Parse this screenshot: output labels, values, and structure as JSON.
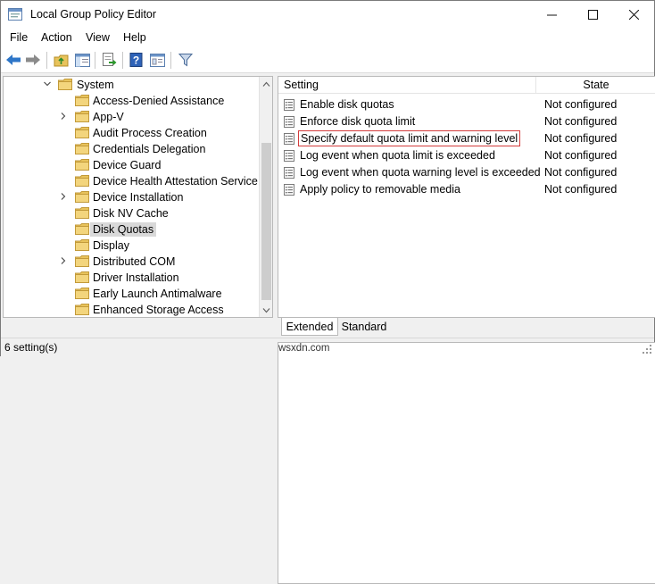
{
  "window": {
    "title": "Local Group Policy Editor",
    "min_glyph": "—",
    "max_glyph": "☐",
    "close_glyph": "✕"
  },
  "menu": [
    "File",
    "Action",
    "View",
    "Help"
  ],
  "toolbar": {
    "icons": [
      "back-arrow-icon",
      "forward-arrow-icon",
      "up-folder-icon",
      "show-hide-tree-icon",
      "export-list-icon",
      "help-icon",
      "properties-icon",
      "filter-icon"
    ]
  },
  "tree": {
    "root": {
      "label": "System",
      "expanded": true
    },
    "items": [
      {
        "label": "Access-Denied Assistance",
        "expandable": false,
        "selected": false
      },
      {
        "label": "App-V",
        "expandable": true,
        "selected": false
      },
      {
        "label": "Audit Process Creation",
        "expandable": false,
        "selected": false
      },
      {
        "label": "Credentials Delegation",
        "expandable": false,
        "selected": false
      },
      {
        "label": "Device Guard",
        "expandable": false,
        "selected": false
      },
      {
        "label": "Device Health Attestation Service",
        "expandable": false,
        "selected": false
      },
      {
        "label": "Device Installation",
        "expandable": true,
        "selected": false
      },
      {
        "label": "Disk NV Cache",
        "expandable": false,
        "selected": false
      },
      {
        "label": "Disk Quotas",
        "expandable": false,
        "selected": true
      },
      {
        "label": "Display",
        "expandable": false,
        "selected": false
      },
      {
        "label": "Distributed COM",
        "expandable": true,
        "selected": false
      },
      {
        "label": "Driver Installation",
        "expandable": false,
        "selected": false
      },
      {
        "label": "Early Launch Antimalware",
        "expandable": false,
        "selected": false
      },
      {
        "label": "Enhanced Storage Access",
        "expandable": false,
        "selected": false
      }
    ]
  },
  "list": {
    "columns": {
      "setting": "Setting",
      "state": "State"
    },
    "rows": [
      {
        "setting": "Enable disk quotas",
        "state": "Not configured",
        "highlighted": false
      },
      {
        "setting": "Enforce disk quota limit",
        "state": "Not configured",
        "highlighted": false
      },
      {
        "setting": "Specify default quota limit and warning level",
        "state": "Not configured",
        "highlighted": true
      },
      {
        "setting": "Log event when quota limit is exceeded",
        "state": "Not configured",
        "highlighted": false
      },
      {
        "setting": "Log event when quota warning level is exceeded",
        "state": "Not configured",
        "highlighted": false
      },
      {
        "setting": "Apply policy to removable media",
        "state": "Not configured",
        "highlighted": false
      }
    ]
  },
  "tabs": {
    "extended": "Extended",
    "standard": "Standard",
    "active": "Extended"
  },
  "status": {
    "count_text": "6 setting(s)",
    "watermark": "wsxdn.com"
  },
  "colors": {
    "highlight_border": "#d43c3c",
    "selection_bg": "#d9d9d9",
    "folder": "#e8c35c"
  }
}
